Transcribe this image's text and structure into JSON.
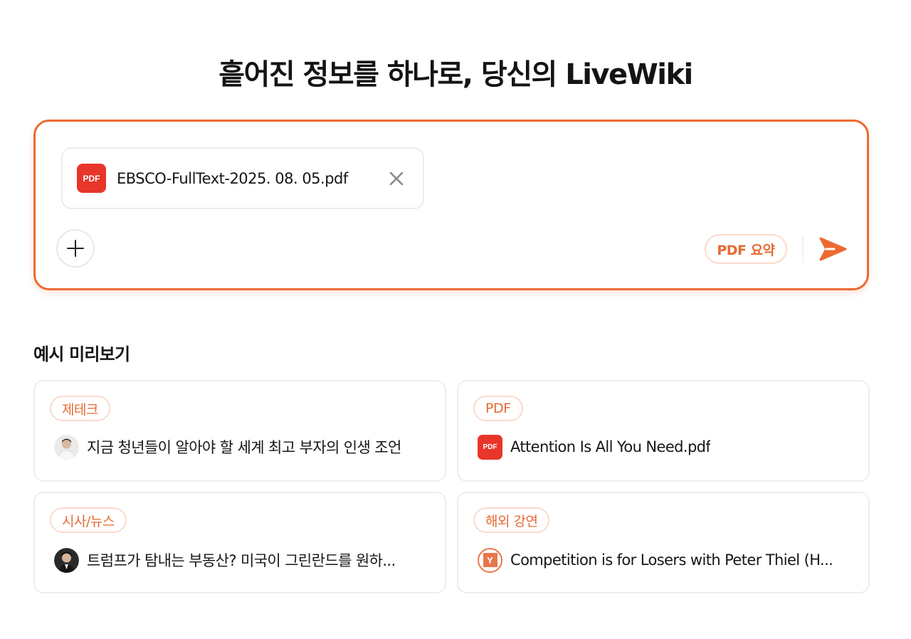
{
  "headline": "흩어진 정보를 하나로, 당신의 LiveWiki",
  "composer": {
    "attachment": {
      "icon": "pdf-file-icon",
      "badge": "PDF",
      "file_name": "EBSCO-FullText-2025. 08. 05.pdf",
      "remove_icon": "close-icon"
    },
    "add_icon": "plus-icon",
    "action_label": "PDF 요약",
    "send_icon": "send-icon",
    "accent_color": "#ec6a32"
  },
  "examples": {
    "title": "예시 미리보기",
    "cards": [
      {
        "tag": "제테크",
        "thumb": "avatar",
        "title": "지금 청년들이 알아야 할 세계 최고 부자의 인생 조언"
      },
      {
        "tag": "PDF",
        "thumb": "pdf-file-icon",
        "thumb_text": "PDF",
        "title": "Attention Is All You Need.pdf"
      },
      {
        "tag": "시사/뉴스",
        "thumb": "avatar",
        "title": "트럼프가 탐내는 부동산? 미국이 그린란드를 원하..."
      },
      {
        "tag": "해외 강연",
        "thumb": "ycombinator-icon",
        "thumb_text": "Y",
        "title": "Competition is for Losers with Peter Thiel (H..."
      }
    ]
  }
}
